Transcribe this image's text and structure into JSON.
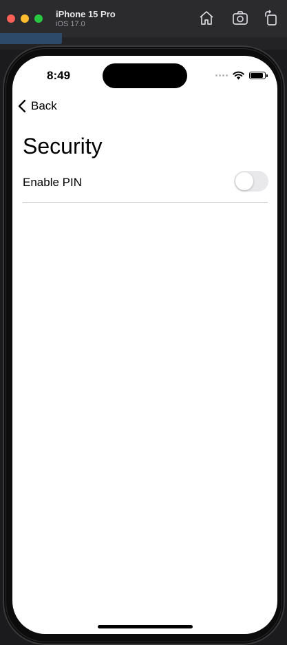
{
  "simulator": {
    "device_name": "iPhone 15 Pro",
    "os_version": "iOS 17.0",
    "toolbar_icons": [
      "home-icon",
      "screenshot-icon",
      "rotate-icon"
    ]
  },
  "status_bar": {
    "time": "8:49",
    "icons": [
      "cellular-dots-icon",
      "wifi-icon",
      "battery-icon"
    ]
  },
  "nav": {
    "back_label": "Back"
  },
  "page": {
    "title": "Security",
    "settings": [
      {
        "label": "Enable PIN",
        "type": "toggle",
        "enabled": false
      }
    ]
  },
  "colors": {
    "toggle_off": "#e9e9eb",
    "background": "#ffffff",
    "divider": "#c6c6c8"
  }
}
